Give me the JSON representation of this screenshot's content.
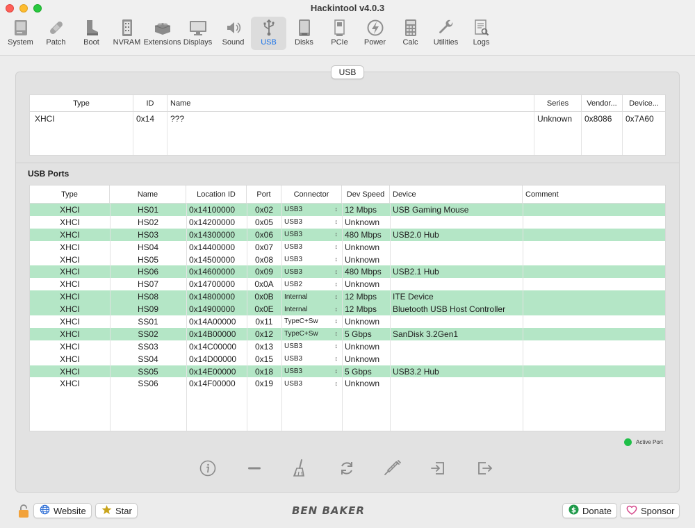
{
  "app": {
    "title": "Hackintool v4.0.3"
  },
  "toolbar": {
    "items": [
      {
        "label": "System",
        "icon": "computer-icon"
      },
      {
        "label": "Patch",
        "icon": "bandage-icon"
      },
      {
        "label": "Boot",
        "icon": "boot-icon"
      },
      {
        "label": "NVRAM",
        "icon": "nvram-icon"
      },
      {
        "label": "Extensions",
        "icon": "lego-icon"
      },
      {
        "label": "Displays",
        "icon": "display-icon"
      },
      {
        "label": "Sound",
        "icon": "speaker-icon"
      },
      {
        "label": "USB",
        "icon": "usb-icon",
        "active": true
      },
      {
        "label": "Disks",
        "icon": "disk-icon"
      },
      {
        "label": "PCIe",
        "icon": "pcie-icon"
      },
      {
        "label": "Power",
        "icon": "power-icon"
      },
      {
        "label": "Calc",
        "icon": "calculator-icon"
      },
      {
        "label": "Utilities",
        "icon": "wrench-icon"
      },
      {
        "label": "Logs",
        "icon": "logs-icon"
      }
    ]
  },
  "tab": {
    "label": "USB"
  },
  "controllers": {
    "headers": [
      "Type",
      "ID",
      "Name",
      "Series",
      "Vendor...",
      "Device..."
    ],
    "rows": [
      {
        "type": "XHCI",
        "id": "0x14",
        "name": "???",
        "series": "Unknown",
        "vendor": "0x8086",
        "device": "0x7A60"
      }
    ]
  },
  "ports": {
    "section_title": "USB Ports",
    "headers": [
      "Type",
      "Name",
      "Location ID",
      "Port",
      "Connector",
      "Dev Speed",
      "Device",
      "Comment"
    ],
    "rows": [
      {
        "type": "XHCI",
        "name": "HS01",
        "location": "0x14100000",
        "port": "0x02",
        "connector": "USB3",
        "speed": "12 Mbps",
        "device": "USB Gaming Mouse",
        "comment": "",
        "active": true
      },
      {
        "type": "XHCI",
        "name": "HS02",
        "location": "0x14200000",
        "port": "0x05",
        "connector": "USB3",
        "speed": "Unknown",
        "device": "",
        "comment": "",
        "active": false
      },
      {
        "type": "XHCI",
        "name": "HS03",
        "location": "0x14300000",
        "port": "0x06",
        "connector": "USB3",
        "speed": "480 Mbps",
        "device": "USB2.0 Hub",
        "comment": "",
        "active": true
      },
      {
        "type": "XHCI",
        "name": "HS04",
        "location": "0x14400000",
        "port": "0x07",
        "connector": "USB3",
        "speed": "Unknown",
        "device": "",
        "comment": "",
        "active": false
      },
      {
        "type": "XHCI",
        "name": "HS05",
        "location": "0x14500000",
        "port": "0x08",
        "connector": "USB3",
        "speed": "Unknown",
        "device": "",
        "comment": "",
        "active": false
      },
      {
        "type": "XHCI",
        "name": "HS06",
        "location": "0x14600000",
        "port": "0x09",
        "connector": "USB3",
        "speed": "480 Mbps",
        "device": "USB2.1 Hub",
        "comment": "",
        "active": true
      },
      {
        "type": "XHCI",
        "name": "HS07",
        "location": "0x14700000",
        "port": "0x0A",
        "connector": "USB2",
        "speed": "Unknown",
        "device": "",
        "comment": "",
        "active": false
      },
      {
        "type": "XHCI",
        "name": "HS08",
        "location": "0x14800000",
        "port": "0x0B",
        "connector": "Internal",
        "speed": "12 Mbps",
        "device": "ITE Device",
        "comment": "",
        "active": true
      },
      {
        "type": "XHCI",
        "name": "HS09",
        "location": "0x14900000",
        "port": "0x0E",
        "connector": "Internal",
        "speed": "12 Mbps",
        "device": "Bluetooth USB Host Controller",
        "comment": "",
        "active": true
      },
      {
        "type": "XHCI",
        "name": "SS01",
        "location": "0x14A00000",
        "port": "0x11",
        "connector": "TypeC+Sw",
        "speed": "Unknown",
        "device": "",
        "comment": "",
        "active": false
      },
      {
        "type": "XHCI",
        "name": "SS02",
        "location": "0x14B00000",
        "port": "0x12",
        "connector": "TypeC+Sw",
        "speed": "5 Gbps",
        "device": " SanDisk 3.2Gen1",
        "comment": "",
        "active": true
      },
      {
        "type": "XHCI",
        "name": "SS03",
        "location": "0x14C00000",
        "port": "0x13",
        "connector": "USB3",
        "speed": "Unknown",
        "device": "",
        "comment": "",
        "active": false
      },
      {
        "type": "XHCI",
        "name": "SS04",
        "location": "0x14D00000",
        "port": "0x15",
        "connector": "USB3",
        "speed": "Unknown",
        "device": "",
        "comment": "",
        "active": false
      },
      {
        "type": "XHCI",
        "name": "SS05",
        "location": "0x14E00000",
        "port": "0x18",
        "connector": "USB3",
        "speed": "5 Gbps",
        "device": "USB3.2 Hub",
        "comment": "",
        "active": true
      },
      {
        "type": "XHCI",
        "name": "SS06",
        "location": "0x14F00000",
        "port": "0x19",
        "connector": "USB3",
        "speed": "Unknown",
        "device": "",
        "comment": "",
        "active": false
      }
    ]
  },
  "legend": {
    "label": "Active Port",
    "color": "#1fbf48"
  },
  "actions": [
    {
      "icon": "info-icon"
    },
    {
      "icon": "minus-icon"
    },
    {
      "icon": "broom-icon"
    },
    {
      "icon": "refresh-icon"
    },
    {
      "icon": "syringe-icon"
    },
    {
      "icon": "import-icon"
    },
    {
      "icon": "export-icon"
    }
  ],
  "footer": {
    "website_label": "Website",
    "star_label": "Star",
    "logo_text": "BEN BAKER",
    "donate_label": "Donate",
    "sponsor_label": "Sponsor"
  },
  "colors": {
    "active_row": "#b4e6c6",
    "accent": "#1a73e8"
  }
}
